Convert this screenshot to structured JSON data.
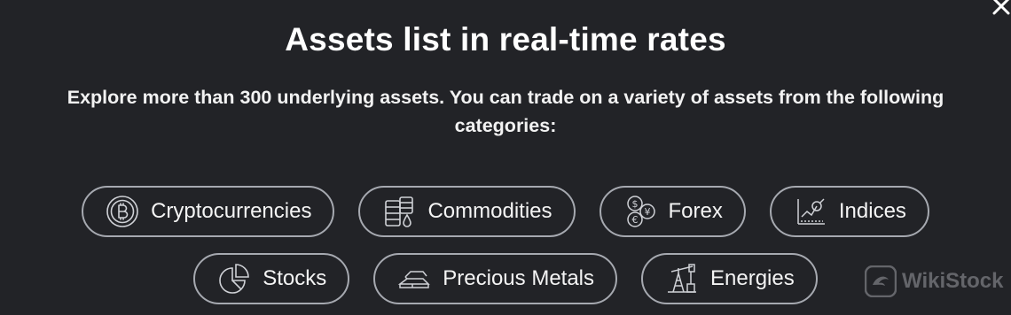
{
  "modal": {
    "title": "Assets list in real-time rates",
    "subtitle_line1": "Explore more than 300 underlying assets. You can trade on a variety of assets from the following",
    "subtitle_line2": "categories:"
  },
  "categories_row1": [
    {
      "label": "Cryptocurrencies",
      "icon": "bitcoin-icon"
    },
    {
      "label": "Commodities",
      "icon": "barrels-icon"
    },
    {
      "label": "Forex",
      "icon": "currency-exchange-icon"
    },
    {
      "label": "Indices",
      "icon": "chart-icon"
    }
  ],
  "categories_row2": [
    {
      "label": "Stocks",
      "icon": "pie-chart-icon"
    },
    {
      "label": "Precious Metals",
      "icon": "gold-bars-icon"
    },
    {
      "label": "Energies",
      "icon": "oil-rig-icon"
    }
  ],
  "watermark": {
    "text": "WikiStock",
    "icon": "wikistock-logo-icon"
  },
  "colors": {
    "background": "#222327",
    "chip_border": "#a6a9b0",
    "text": "#ffffff"
  }
}
